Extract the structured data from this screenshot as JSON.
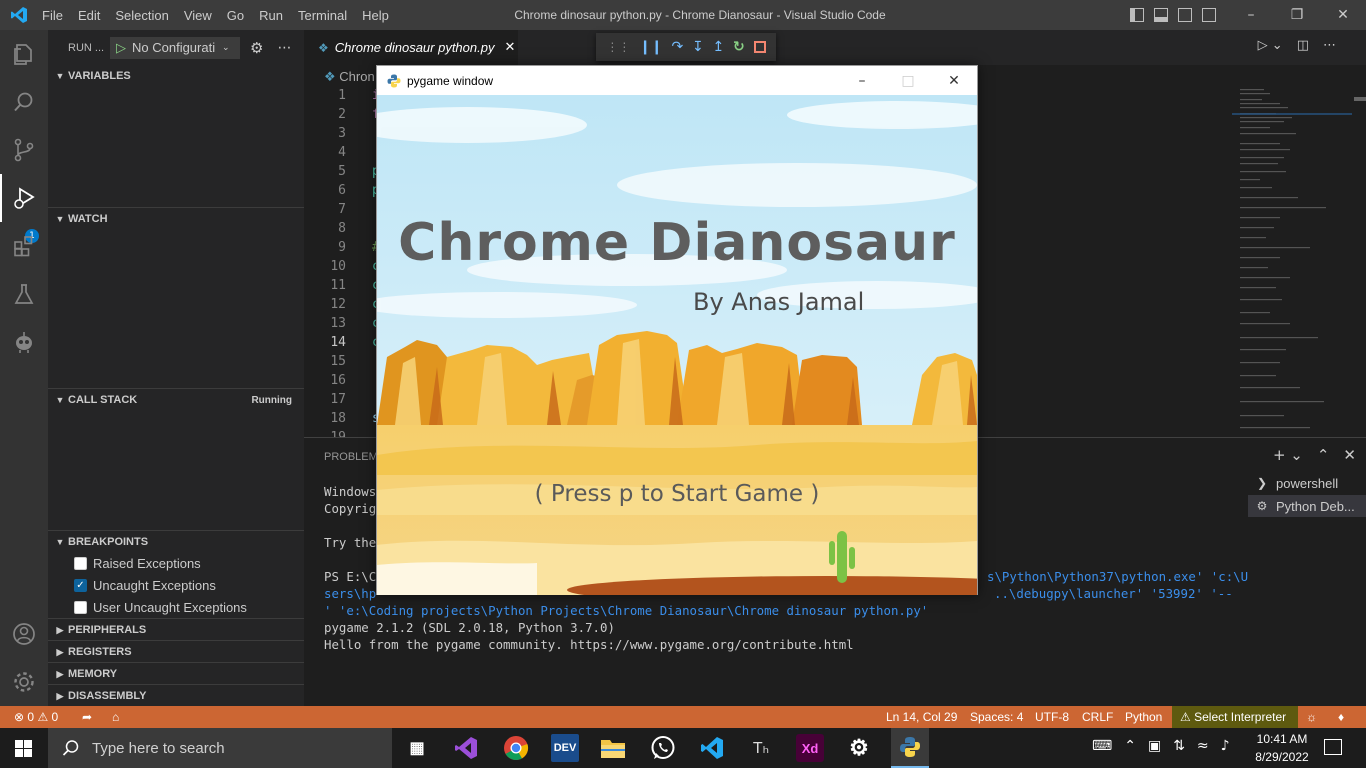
{
  "app": {
    "window_title": "Chrome dinosaur python.py - Chrome Dianosaur - Visual Studio Code",
    "menu": [
      "File",
      "Edit",
      "Selection",
      "View",
      "Go",
      "Run",
      "Terminal",
      "Help"
    ],
    "accent": "#007acc"
  },
  "activity": {
    "items": [
      "explorer-icon",
      "search-icon",
      "source-control-icon",
      "run-debug-icon",
      "extensions-icon",
      "testing-icon",
      "robot-icon",
      "account-icon",
      "settings-gear-icon"
    ],
    "run_badge": "1"
  },
  "sidebar": {
    "run_title": "RUN ...",
    "config_label": "No Configurati",
    "sections": {
      "variables": "VARIABLES",
      "watch": "WATCH",
      "call_stack": "CALL STACK",
      "call_stack_status": "Running",
      "breakpoints": "BREAKPOINTS",
      "peripherals": "PERIPHERALS",
      "registers": "REGISTERS",
      "memory": "MEMORY",
      "disassembly": "DISASSEMBLY"
    },
    "breakpoints": [
      {
        "label": "Raised Exceptions",
        "checked": false
      },
      {
        "label": "Uncaught Exceptions",
        "checked": true
      },
      {
        "label": "User Uncaught Exceptions",
        "checked": false
      }
    ]
  },
  "editor": {
    "tab_label": "Chrome dinosaur python.py",
    "breadcrumb": "Chron",
    "line_numbers": [
      "1",
      "2",
      "3",
      "4",
      "5",
      "6",
      "7",
      "8",
      "9",
      "10",
      "11",
      "12",
      "13",
      "14",
      "15",
      "16",
      "17",
      "18",
      "19"
    ],
    "current_line": "14",
    "visible_code_prefixes": {
      "1": "i",
      "2": "f",
      "5": "p",
      "6": "p",
      "9": "#",
      "10": "c",
      "11": "c",
      "12": "c",
      "13": "c",
      "14": "c",
      "18": "s"
    }
  },
  "panel": {
    "tab_label": "PROBLEMS",
    "terminal_lines": [
      {
        "text": "Windows",
        "color": "default"
      },
      {
        "text": "Copyrigh",
        "color": "default"
      },
      {
        "text": "",
        "color": "default"
      },
      {
        "text": "Try the",
        "color": "default"
      },
      {
        "text": "",
        "color": "default"
      },
      {
        "text": "PS E:\\Co",
        "color": "default"
      },
      {
        "text": "sers\\hp",
        "color": "blue"
      },
      {
        "text": "' 'e:\\Coding projects\\Python Projects\\Chrome Dianosaur\\Chrome dinosaur python.py'",
        "color": "blue"
      },
      {
        "text": "pygame 2.1.2 (SDL 2.0.18, Python 3.7.0)",
        "color": "default"
      },
      {
        "text": "Hello from the pygame community. https://www.pygame.org/contribute.html",
        "color": "default"
      }
    ],
    "terminal_tail_line6": "s\\Python\\Python37\\python.exe' 'c:\\U",
    "terminal_tail_line7": "..\\debugpy\\launcher' '53992' '--",
    "terminal_list": [
      {
        "label": "powershell",
        "icon": "terminal-icon"
      },
      {
        "label": "Python Deb...",
        "icon": "debug-gear-icon"
      }
    ]
  },
  "statusbar": {
    "errors": "0",
    "warnings": "0",
    "position": "Ln 14, Col 29",
    "spaces": "Spaces: 4",
    "encoding": "UTF-8",
    "eol": "CRLF",
    "language": "Python",
    "interpreter": "Select Interpreter",
    "color": "#cc6633"
  },
  "pygame": {
    "window_title": "pygame window",
    "game_title": "Chrome Dianosaur",
    "author": "By Anas Jamal",
    "prompt": "( Press p to Start Game )"
  },
  "taskbar": {
    "search_placeholder": "Type here to search",
    "apps": [
      "task-view-icon",
      "visual-studio-icon",
      "chrome-icon",
      "devcpp-icon",
      "file-explorer-icon",
      "whatsapp-icon",
      "vscode-icon",
      "typora-icon",
      "adobe-xd-icon",
      "settings-icon",
      "python-icon"
    ],
    "time": "10:41 AM",
    "date": "8/29/2022"
  }
}
